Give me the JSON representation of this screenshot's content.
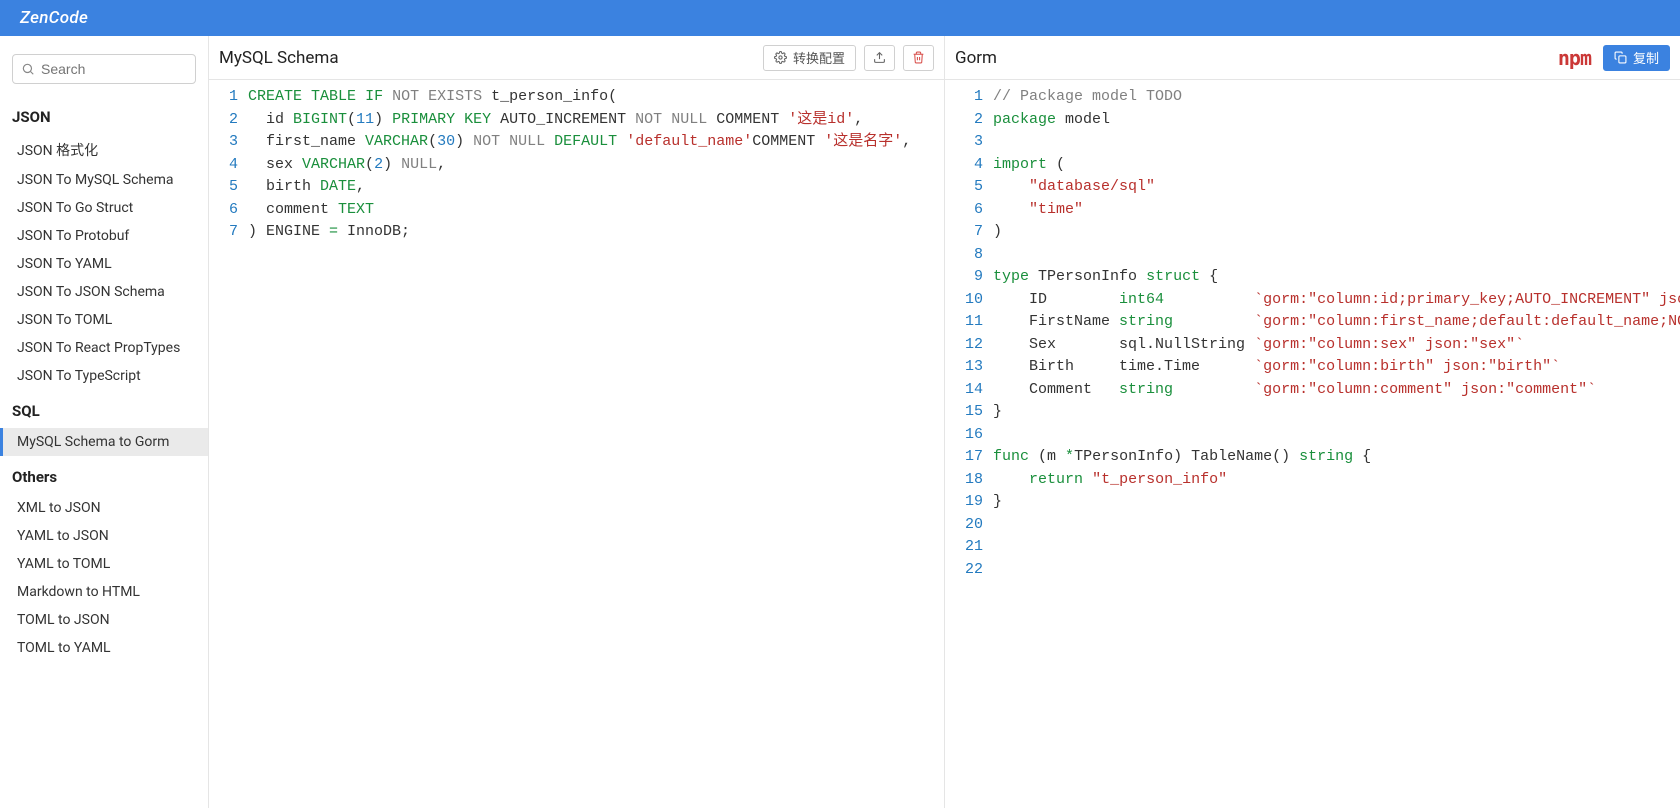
{
  "brand": "ZenCode",
  "search": {
    "placeholder": "Search"
  },
  "sidebar": {
    "groups": [
      {
        "title": "JSON",
        "items": [
          {
            "label": "JSON 格式化"
          },
          {
            "label": "JSON To MySQL Schema"
          },
          {
            "label": "JSON To Go Struct"
          },
          {
            "label": "JSON To Protobuf"
          },
          {
            "label": "JSON To YAML"
          },
          {
            "label": "JSON To JSON Schema"
          },
          {
            "label": "JSON To TOML"
          },
          {
            "label": "JSON To React PropTypes"
          },
          {
            "label": "JSON To TypeScript"
          }
        ]
      },
      {
        "title": "SQL",
        "items": [
          {
            "label": "MySQL Schema to Gorm",
            "active": true
          }
        ]
      },
      {
        "title": "Others",
        "items": [
          {
            "label": "XML to JSON"
          },
          {
            "label": "YAML to JSON"
          },
          {
            "label": "YAML to TOML"
          },
          {
            "label": "Markdown to HTML"
          },
          {
            "label": "TOML to JSON"
          },
          {
            "label": "TOML to YAML"
          }
        ]
      }
    ]
  },
  "left_panel": {
    "title": "MySQL Schema",
    "convert_label": "转换配置",
    "lines": [
      [
        {
          "t": "CREATE",
          "c": "kw"
        },
        {
          "t": " "
        },
        {
          "t": "TABLE",
          "c": "kw"
        },
        {
          "t": " "
        },
        {
          "t": "IF",
          "c": "kw"
        },
        {
          "t": " "
        },
        {
          "t": "NOT",
          "c": "gray"
        },
        {
          "t": " "
        },
        {
          "t": "EXISTS",
          "c": "gray"
        },
        {
          "t": " t_person_info("
        }
      ],
      [
        {
          "t": "  id "
        },
        {
          "t": "BIGINT",
          "c": "type"
        },
        {
          "t": "("
        },
        {
          "t": "11",
          "c": "num"
        },
        {
          "t": ") "
        },
        {
          "t": "PRIMARY",
          "c": "kw"
        },
        {
          "t": " "
        },
        {
          "t": "KEY",
          "c": "kw"
        },
        {
          "t": " AUTO_INCREMENT "
        },
        {
          "t": "NOT",
          "c": "gray"
        },
        {
          "t": " "
        },
        {
          "t": "NULL",
          "c": "gray"
        },
        {
          "t": " COMMENT "
        },
        {
          "t": "'这是id'",
          "c": "str"
        },
        {
          "t": ","
        }
      ],
      [
        {
          "t": "  first_name "
        },
        {
          "t": "VARCHAR",
          "c": "type"
        },
        {
          "t": "("
        },
        {
          "t": "30",
          "c": "num"
        },
        {
          "t": ") "
        },
        {
          "t": "NOT",
          "c": "gray"
        },
        {
          "t": " "
        },
        {
          "t": "NULL",
          "c": "gray"
        },
        {
          "t": " "
        },
        {
          "t": "DEFAULT",
          "c": "kw"
        },
        {
          "t": " "
        },
        {
          "t": "'default_name'",
          "c": "str"
        },
        {
          "t": "COMMENT "
        },
        {
          "t": "'这是名字'",
          "c": "str"
        },
        {
          "t": ","
        }
      ],
      [
        {
          "t": "  sex "
        },
        {
          "t": "VARCHAR",
          "c": "type"
        },
        {
          "t": "("
        },
        {
          "t": "2",
          "c": "num"
        },
        {
          "t": ") "
        },
        {
          "t": "NULL",
          "c": "gray"
        },
        {
          "t": ","
        }
      ],
      [
        {
          "t": "  birth "
        },
        {
          "t": "DATE",
          "c": "type"
        },
        {
          "t": ","
        }
      ],
      [
        {
          "t": "  comment "
        },
        {
          "t": "TEXT",
          "c": "type"
        }
      ],
      [
        {
          "t": ") ENGINE "
        },
        {
          "t": "=",
          "c": "kw"
        },
        {
          "t": " InnoDB;"
        }
      ]
    ]
  },
  "right_panel": {
    "title": "Gorm",
    "copy_label": "复制",
    "lines": [
      [
        {
          "t": "// Package model TODO",
          "c": "comment"
        }
      ],
      [
        {
          "t": "package",
          "c": "kw"
        },
        {
          "t": " model"
        }
      ],
      [],
      [
        {
          "t": "import",
          "c": "kw"
        },
        {
          "t": " ("
        }
      ],
      [
        {
          "t": "    "
        },
        {
          "t": "\"database/sql\"",
          "c": "str"
        }
      ],
      [
        {
          "t": "    "
        },
        {
          "t": "\"time\"",
          "c": "str"
        }
      ],
      [
        {
          "t": ")"
        }
      ],
      [],
      [
        {
          "t": "type",
          "c": "kw"
        },
        {
          "t": " TPersonInfo "
        },
        {
          "t": "struct",
          "c": "kw"
        },
        {
          "t": " {"
        }
      ],
      [
        {
          "t": "    ID        "
        },
        {
          "t": "int64",
          "c": "type"
        },
        {
          "t": "          "
        },
        {
          "t": "`gorm:\"column:id;primary_key;AUTO_INCREMENT\" json:\"id\"`",
          "c": "str"
        }
      ],
      [
        {
          "t": "    FirstName "
        },
        {
          "t": "string",
          "c": "type"
        },
        {
          "t": "         "
        },
        {
          "t": "`gorm:\"column:first_name;default:default_name;NOT NULL\"",
          "c": "str"
        }
      ],
      [
        {
          "t": "    Sex       sql.NullString "
        },
        {
          "t": "`gorm:\"column:sex\" json:\"sex\"`",
          "c": "str"
        }
      ],
      [
        {
          "t": "    Birth     time.Time      "
        },
        {
          "t": "`gorm:\"column:birth\" json:\"birth\"`",
          "c": "str"
        }
      ],
      [
        {
          "t": "    Comment   "
        },
        {
          "t": "string",
          "c": "type"
        },
        {
          "t": "         "
        },
        {
          "t": "`gorm:\"column:comment\" json:\"comment\"`",
          "c": "str"
        }
      ],
      [
        {
          "t": "}"
        }
      ],
      [],
      [
        {
          "t": "func",
          "c": "kw"
        },
        {
          "t": " (m "
        },
        {
          "t": "*",
          "c": "kw"
        },
        {
          "t": "TPersonInfo) TableName() "
        },
        {
          "t": "string",
          "c": "type"
        },
        {
          "t": " {"
        }
      ],
      [
        {
          "t": "    "
        },
        {
          "t": "return",
          "c": "kw"
        },
        {
          "t": " "
        },
        {
          "t": "\"t_person_info\"",
          "c": "str"
        }
      ],
      [
        {
          "t": "}"
        }
      ],
      [],
      [],
      []
    ]
  }
}
